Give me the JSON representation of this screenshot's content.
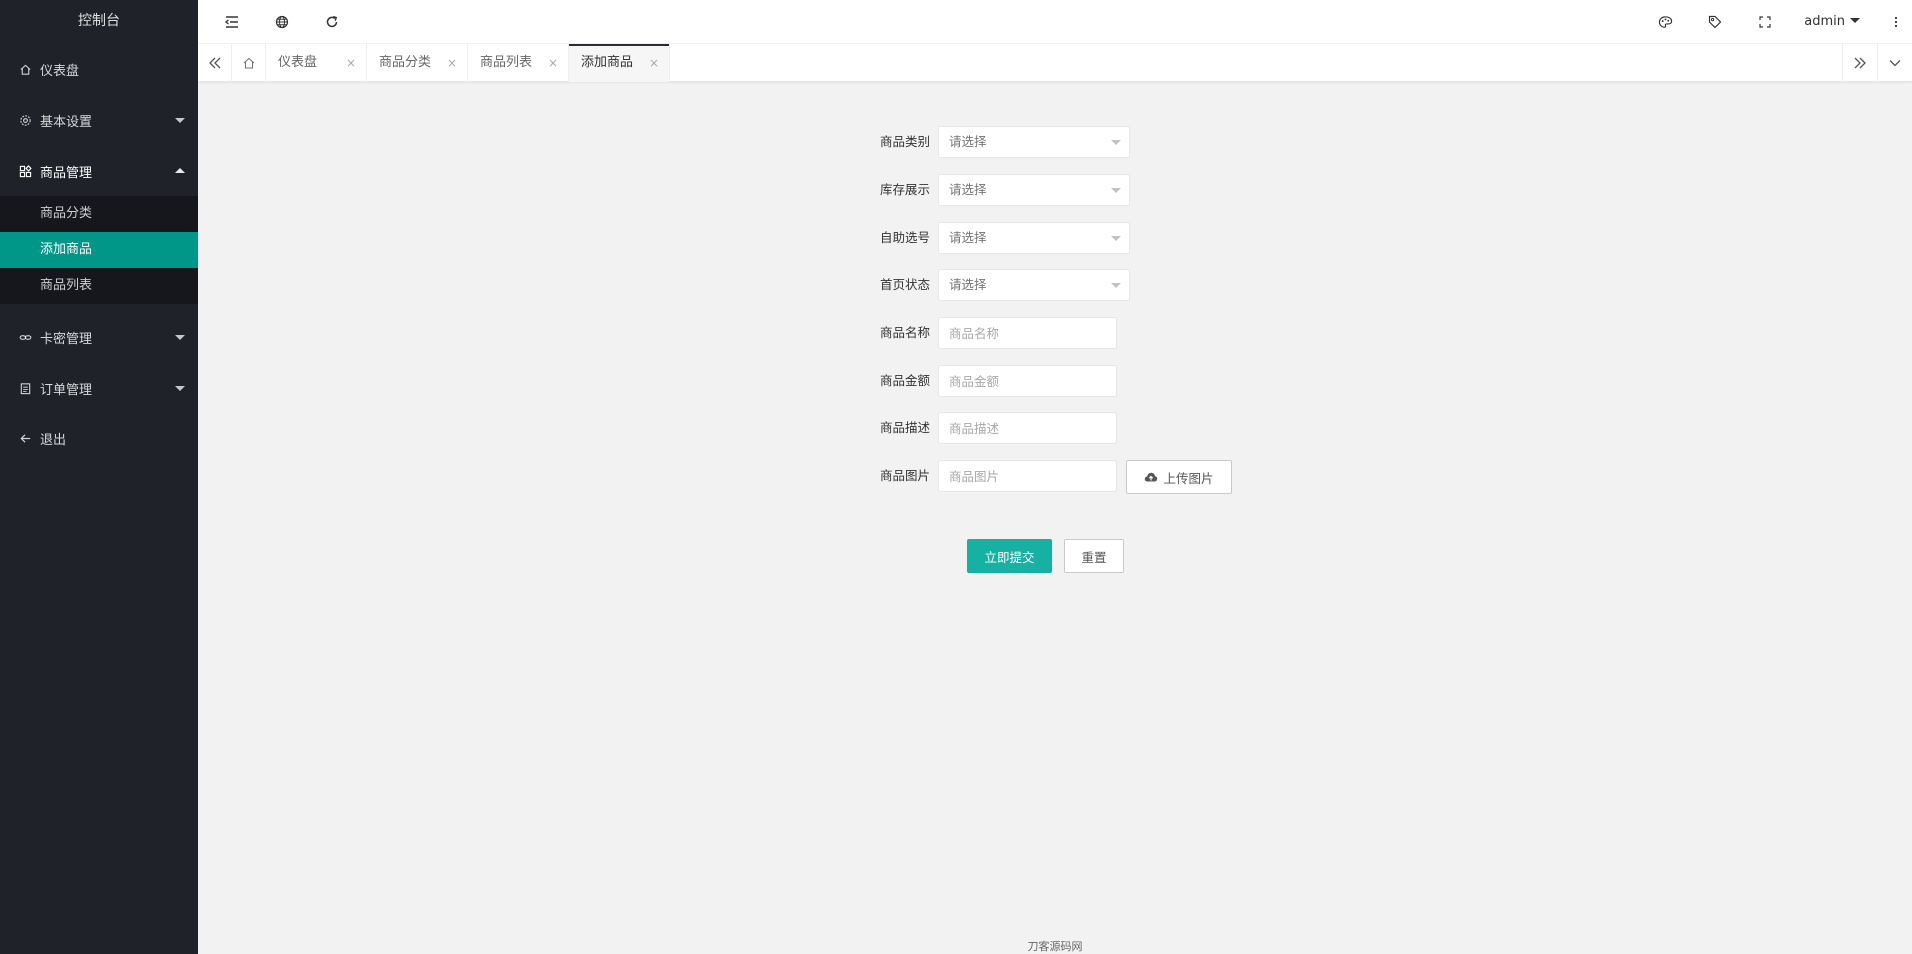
{
  "sidebar": {
    "logo": "控制台",
    "items": [
      {
        "label": "仪表盘",
        "icon": "home-icon"
      },
      {
        "label": "基本设置",
        "icon": "gear-icon"
      },
      {
        "label": "商品管理",
        "icon": "apps-icon"
      },
      {
        "label": "卡密管理",
        "icon": "link-icon"
      },
      {
        "label": "订单管理",
        "icon": "clipboard-icon"
      },
      {
        "label": "退出",
        "icon": "arrow-left-icon"
      }
    ],
    "submenu": [
      {
        "label": "商品分类"
      },
      {
        "label": "添加商品"
      },
      {
        "label": "商品列表"
      }
    ]
  },
  "header": {
    "user": "admin"
  },
  "tabs": [
    {
      "label": "仪表盘"
    },
    {
      "label": "商品分类"
    },
    {
      "label": "商品列表"
    },
    {
      "label": "添加商品"
    }
  ],
  "tab_close": "×",
  "form": {
    "category": {
      "label": "商品类别",
      "value": "请选择"
    },
    "stock_display": {
      "label": "库存展示",
      "value": "请选择"
    },
    "self_select": {
      "label": "自助选号",
      "value": "请选择"
    },
    "home_status": {
      "label": "首页状态",
      "value": "请选择"
    },
    "name": {
      "label": "商品名称",
      "placeholder": "商品名称"
    },
    "amount": {
      "label": "商品金额",
      "placeholder": "商品金额"
    },
    "description": {
      "label": "商品描述",
      "placeholder": "商品描述"
    },
    "image": {
      "label": "商品图片",
      "placeholder": "商品图片",
      "upload_label": "上传图片"
    },
    "submit_label": "立即提交",
    "reset_label": "重置"
  },
  "footer": "刀客源码网",
  "colors": {
    "sidebar_bg": "#20222a",
    "active_green": "#009688",
    "submit_green": "#16b1a3"
  }
}
